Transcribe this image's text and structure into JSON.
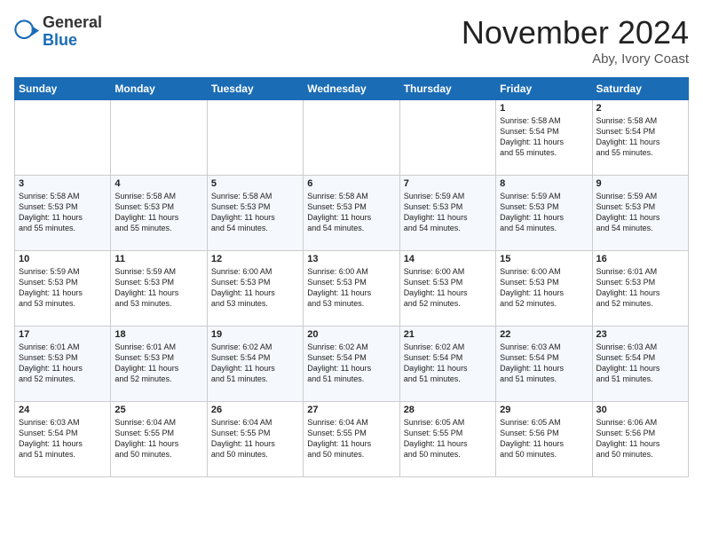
{
  "header": {
    "logo_line1": "General",
    "logo_line2": "Blue",
    "month_title": "November 2024",
    "location": "Aby, Ivory Coast"
  },
  "weekdays": [
    "Sunday",
    "Monday",
    "Tuesday",
    "Wednesday",
    "Thursday",
    "Friday",
    "Saturday"
  ],
  "weeks": [
    [
      {
        "day": "",
        "text": ""
      },
      {
        "day": "",
        "text": ""
      },
      {
        "day": "",
        "text": ""
      },
      {
        "day": "",
        "text": ""
      },
      {
        "day": "",
        "text": ""
      },
      {
        "day": "1",
        "text": "Sunrise: 5:58 AM\nSunset: 5:54 PM\nDaylight: 11 hours\nand 55 minutes."
      },
      {
        "day": "2",
        "text": "Sunrise: 5:58 AM\nSunset: 5:54 PM\nDaylight: 11 hours\nand 55 minutes."
      }
    ],
    [
      {
        "day": "3",
        "text": "Sunrise: 5:58 AM\nSunset: 5:53 PM\nDaylight: 11 hours\nand 55 minutes."
      },
      {
        "day": "4",
        "text": "Sunrise: 5:58 AM\nSunset: 5:53 PM\nDaylight: 11 hours\nand 55 minutes."
      },
      {
        "day": "5",
        "text": "Sunrise: 5:58 AM\nSunset: 5:53 PM\nDaylight: 11 hours\nand 54 minutes."
      },
      {
        "day": "6",
        "text": "Sunrise: 5:58 AM\nSunset: 5:53 PM\nDaylight: 11 hours\nand 54 minutes."
      },
      {
        "day": "7",
        "text": "Sunrise: 5:59 AM\nSunset: 5:53 PM\nDaylight: 11 hours\nand 54 minutes."
      },
      {
        "day": "8",
        "text": "Sunrise: 5:59 AM\nSunset: 5:53 PM\nDaylight: 11 hours\nand 54 minutes."
      },
      {
        "day": "9",
        "text": "Sunrise: 5:59 AM\nSunset: 5:53 PM\nDaylight: 11 hours\nand 54 minutes."
      }
    ],
    [
      {
        "day": "10",
        "text": "Sunrise: 5:59 AM\nSunset: 5:53 PM\nDaylight: 11 hours\nand 53 minutes."
      },
      {
        "day": "11",
        "text": "Sunrise: 5:59 AM\nSunset: 5:53 PM\nDaylight: 11 hours\nand 53 minutes."
      },
      {
        "day": "12",
        "text": "Sunrise: 6:00 AM\nSunset: 5:53 PM\nDaylight: 11 hours\nand 53 minutes."
      },
      {
        "day": "13",
        "text": "Sunrise: 6:00 AM\nSunset: 5:53 PM\nDaylight: 11 hours\nand 53 minutes."
      },
      {
        "day": "14",
        "text": "Sunrise: 6:00 AM\nSunset: 5:53 PM\nDaylight: 11 hours\nand 52 minutes."
      },
      {
        "day": "15",
        "text": "Sunrise: 6:00 AM\nSunset: 5:53 PM\nDaylight: 11 hours\nand 52 minutes."
      },
      {
        "day": "16",
        "text": "Sunrise: 6:01 AM\nSunset: 5:53 PM\nDaylight: 11 hours\nand 52 minutes."
      }
    ],
    [
      {
        "day": "17",
        "text": "Sunrise: 6:01 AM\nSunset: 5:53 PM\nDaylight: 11 hours\nand 52 minutes."
      },
      {
        "day": "18",
        "text": "Sunrise: 6:01 AM\nSunset: 5:53 PM\nDaylight: 11 hours\nand 52 minutes."
      },
      {
        "day": "19",
        "text": "Sunrise: 6:02 AM\nSunset: 5:54 PM\nDaylight: 11 hours\nand 51 minutes."
      },
      {
        "day": "20",
        "text": "Sunrise: 6:02 AM\nSunset: 5:54 PM\nDaylight: 11 hours\nand 51 minutes."
      },
      {
        "day": "21",
        "text": "Sunrise: 6:02 AM\nSunset: 5:54 PM\nDaylight: 11 hours\nand 51 minutes."
      },
      {
        "day": "22",
        "text": "Sunrise: 6:03 AM\nSunset: 5:54 PM\nDaylight: 11 hours\nand 51 minutes."
      },
      {
        "day": "23",
        "text": "Sunrise: 6:03 AM\nSunset: 5:54 PM\nDaylight: 11 hours\nand 51 minutes."
      }
    ],
    [
      {
        "day": "24",
        "text": "Sunrise: 6:03 AM\nSunset: 5:54 PM\nDaylight: 11 hours\nand 51 minutes."
      },
      {
        "day": "25",
        "text": "Sunrise: 6:04 AM\nSunset: 5:55 PM\nDaylight: 11 hours\nand 50 minutes."
      },
      {
        "day": "26",
        "text": "Sunrise: 6:04 AM\nSunset: 5:55 PM\nDaylight: 11 hours\nand 50 minutes."
      },
      {
        "day": "27",
        "text": "Sunrise: 6:04 AM\nSunset: 5:55 PM\nDaylight: 11 hours\nand 50 minutes."
      },
      {
        "day": "28",
        "text": "Sunrise: 6:05 AM\nSunset: 5:55 PM\nDaylight: 11 hours\nand 50 minutes."
      },
      {
        "day": "29",
        "text": "Sunrise: 6:05 AM\nSunset: 5:56 PM\nDaylight: 11 hours\nand 50 minutes."
      },
      {
        "day": "30",
        "text": "Sunrise: 6:06 AM\nSunset: 5:56 PM\nDaylight: 11 hours\nand 50 minutes."
      }
    ]
  ]
}
